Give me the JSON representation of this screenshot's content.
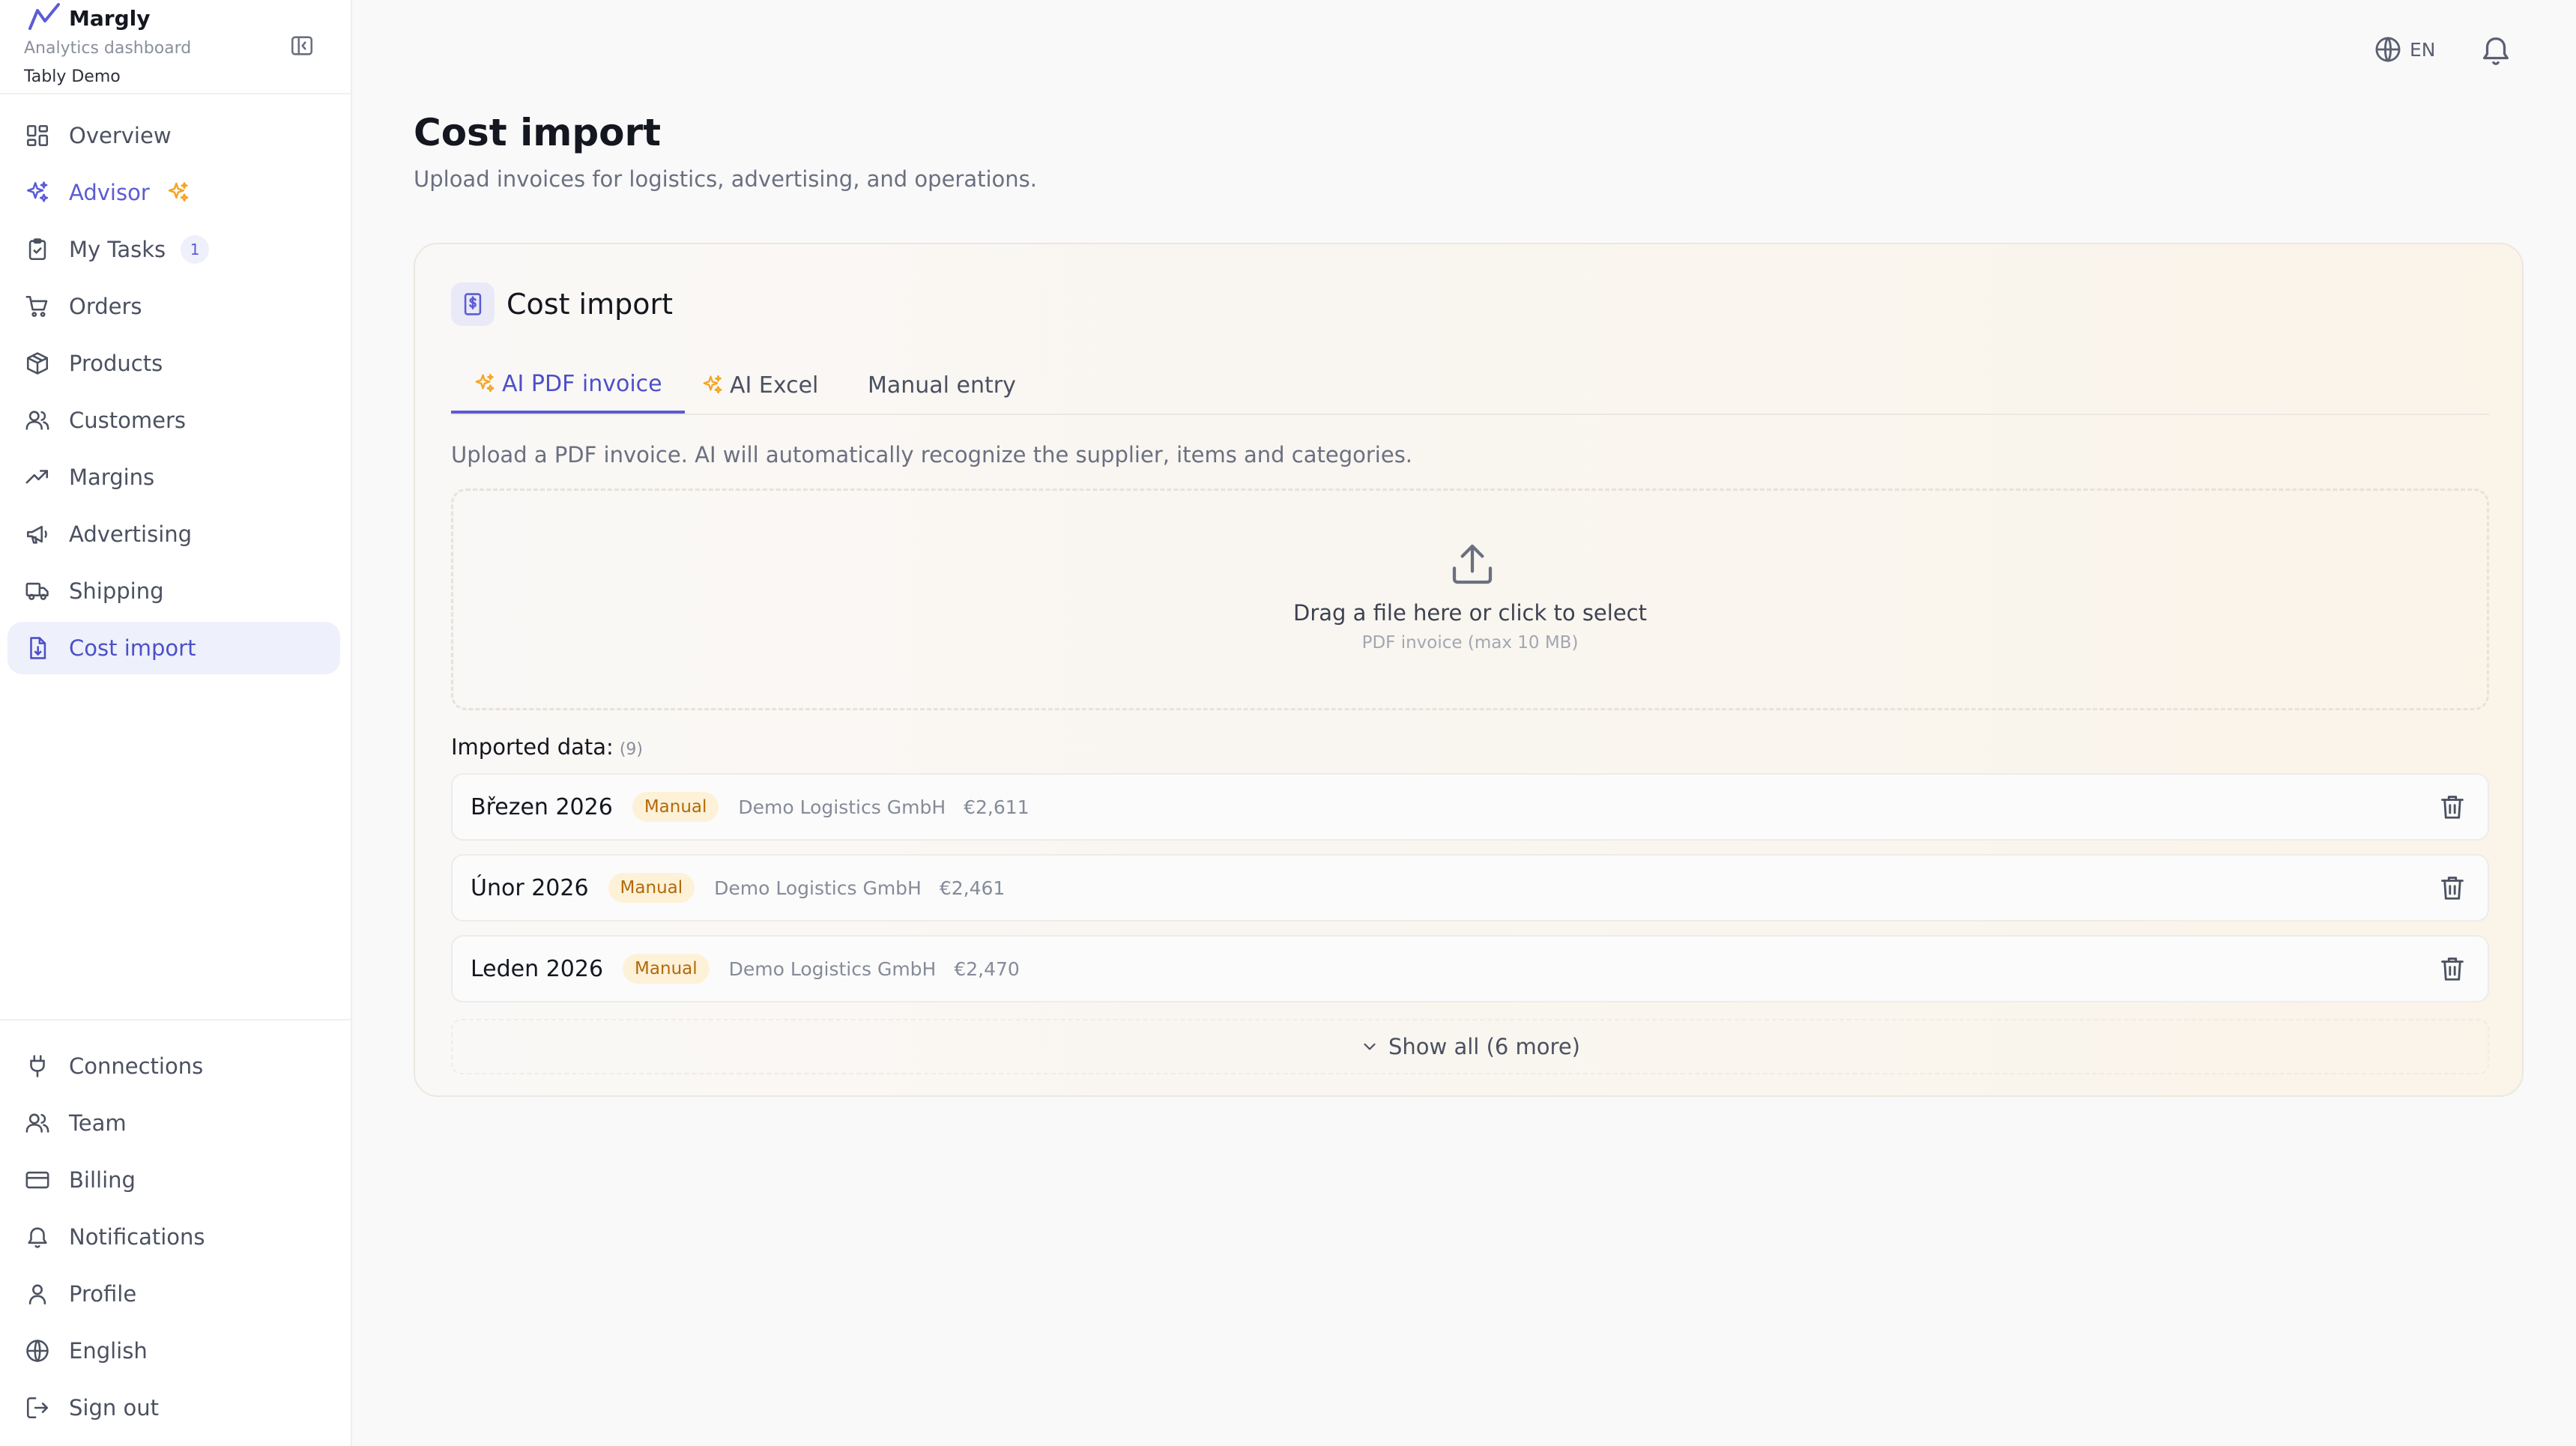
{
  "app": {
    "name": "Margly",
    "subtitle": "Analytics dashboard",
    "organization": "Tably Demo"
  },
  "sidebar": {
    "items": [
      {
        "label": "Overview",
        "icon": "grid-icon"
      },
      {
        "label": "Advisor",
        "icon": "sparkles-icon"
      },
      {
        "label": "My Tasks",
        "icon": "clipboard-check-icon",
        "badge": "1"
      },
      {
        "label": "Orders",
        "icon": "cart-icon"
      },
      {
        "label": "Products",
        "icon": "box-icon"
      },
      {
        "label": "Customers",
        "icon": "users-icon"
      },
      {
        "label": "Margins",
        "icon": "trending-up-icon"
      },
      {
        "label": "Advertising",
        "icon": "megaphone-icon"
      },
      {
        "label": "Shipping",
        "icon": "truck-icon"
      },
      {
        "label": "Cost import",
        "icon": "file-import-icon",
        "active": true
      }
    ],
    "bottom_items": [
      {
        "label": "Connections",
        "icon": "plug-icon"
      },
      {
        "label": "Team",
        "icon": "users-icon"
      },
      {
        "label": "Billing",
        "icon": "credit-card-icon"
      },
      {
        "label": "Notifications",
        "icon": "bell-icon"
      },
      {
        "label": "Profile",
        "icon": "user-icon"
      },
      {
        "label": "English",
        "icon": "globe-icon"
      },
      {
        "label": "Sign out",
        "icon": "logout-icon"
      }
    ]
  },
  "topbar": {
    "language": "EN"
  },
  "page": {
    "title": "Cost import",
    "subtitle": "Upload invoices for logistics, advertising, and operations."
  },
  "card": {
    "title": "Cost import",
    "tabs": [
      {
        "label": "AI PDF invoice",
        "active": true
      },
      {
        "label": "AI Excel"
      },
      {
        "label": "Manual entry"
      }
    ],
    "upload_description": "Upload a PDF invoice. AI will automatically recognize the supplier, items and categories.",
    "dropzone": {
      "title": "Drag a file here or click to select",
      "hint": "PDF invoice (max 10 MB)"
    },
    "imported_label": "Imported data:",
    "imported_count": "(9)",
    "rows": [
      {
        "period": "Březen 2026",
        "tag": "Manual",
        "supplier": "Demo Logistics GmbH",
        "amount": "€2,611"
      },
      {
        "period": "Únor 2026",
        "tag": "Manual",
        "supplier": "Demo Logistics GmbH",
        "amount": "€2,461"
      },
      {
        "period": "Leden 2026",
        "tag": "Manual",
        "supplier": "Demo Logistics GmbH",
        "amount": "€2,470"
      }
    ],
    "show_all": "Show all (6 more)"
  },
  "colors": {
    "accent": "#5b5bd6",
    "active_bg": "#eef0fb",
    "tag_bg": "#fdf1d8",
    "tag_text": "#b26a0a",
    "spark": "#f5a524"
  }
}
